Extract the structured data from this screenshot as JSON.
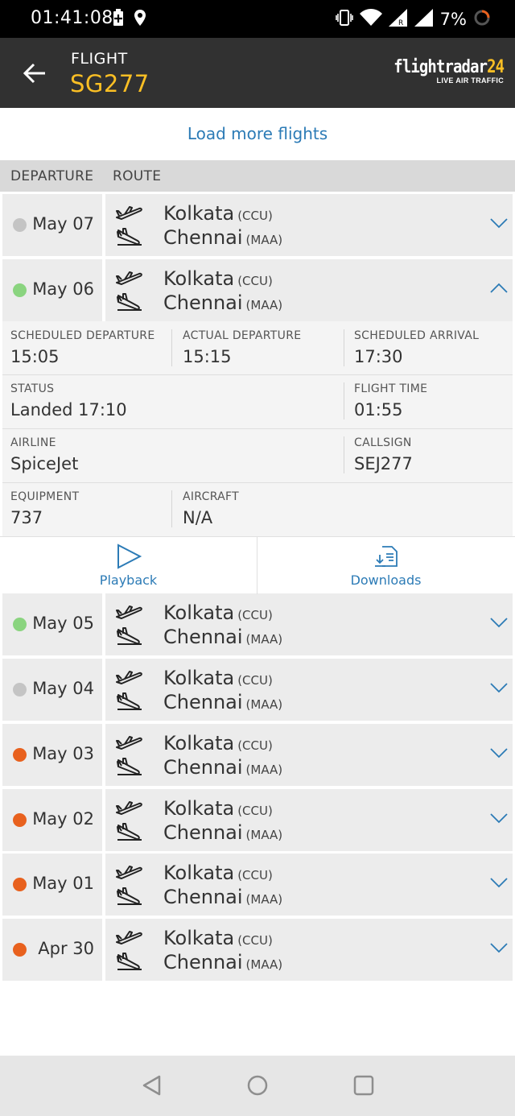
{
  "status_bar": {
    "time": "01:41:08",
    "battery": "7%",
    "icons": [
      "battery-saver-icon",
      "location-icon",
      "vibrate-icon",
      "wifi-icon",
      "signal-roaming-icon",
      "signal-icon",
      "loading-ring-icon"
    ]
  },
  "header": {
    "label": "FLIGHT",
    "flight_number": "SG277",
    "logo_text_main": "flightradar",
    "logo_text_accent": "24",
    "logo_subtitle": "LIVE AIR TRAFFIC",
    "back_icon": "arrow-left-icon"
  },
  "load_more_label": "Load more flights",
  "columns": {
    "departure": "DEPARTURE",
    "route": "ROUTE"
  },
  "status_colors": {
    "grey": "#c4c4c4",
    "green": "#8ad47f",
    "orange": "#e8611e"
  },
  "flights": [
    {
      "date": "May 07",
      "status": "grey",
      "from": "Kolkata",
      "from_code": "(CCU)",
      "to": "Chennai",
      "to_code": "(MAA)",
      "expanded": false
    },
    {
      "date": "May 06",
      "status": "green",
      "from": "Kolkata",
      "from_code": "(CCU)",
      "to": "Chennai",
      "to_code": "(MAA)",
      "expanded": true
    },
    {
      "date": "May 05",
      "status": "green",
      "from": "Kolkata",
      "from_code": "(CCU)",
      "to": "Chennai",
      "to_code": "(MAA)",
      "expanded": false
    },
    {
      "date": "May 04",
      "status": "grey",
      "from": "Kolkata",
      "from_code": "(CCU)",
      "to": "Chennai",
      "to_code": "(MAA)",
      "expanded": false
    },
    {
      "date": "May 03",
      "status": "orange",
      "from": "Kolkata",
      "from_code": "(CCU)",
      "to": "Chennai",
      "to_code": "(MAA)",
      "expanded": false
    },
    {
      "date": "May 02",
      "status": "orange",
      "from": "Kolkata",
      "from_code": "(CCU)",
      "to": "Chennai",
      "to_code": "(MAA)",
      "expanded": false
    },
    {
      "date": "May 01",
      "status": "orange",
      "from": "Kolkata",
      "from_code": "(CCU)",
      "to": "Chennai",
      "to_code": "(MAA)",
      "expanded": false
    },
    {
      "date": "Apr 30",
      "status": "orange",
      "from": "Kolkata",
      "from_code": "(CCU)",
      "to": "Chennai",
      "to_code": "(MAA)",
      "expanded": false
    }
  ],
  "details": {
    "scheduled_departure": {
      "label": "SCHEDULED DEPARTURE",
      "value": "15:05"
    },
    "actual_departure": {
      "label": "ACTUAL DEPARTURE",
      "value": "15:15"
    },
    "scheduled_arrival": {
      "label": "SCHEDULED ARRIVAL",
      "value": "17:30"
    },
    "status": {
      "label": "STATUS",
      "value": "Landed 17:10"
    },
    "flight_time": {
      "label": "FLIGHT TIME",
      "value": "01:55"
    },
    "airline": {
      "label": "AIRLINE",
      "value": "SpiceJet"
    },
    "callsign": {
      "label": "CALLSIGN",
      "value": "SEJ277"
    },
    "equipment": {
      "label": "EQUIPMENT",
      "value": "737"
    },
    "aircraft": {
      "label": "AIRCRAFT",
      "value": "N/A"
    }
  },
  "actions": {
    "playback": "Playback",
    "downloads": "Downloads"
  },
  "nav_bar": [
    "back-triangle-icon",
    "home-circle-icon",
    "recents-square-icon"
  ]
}
